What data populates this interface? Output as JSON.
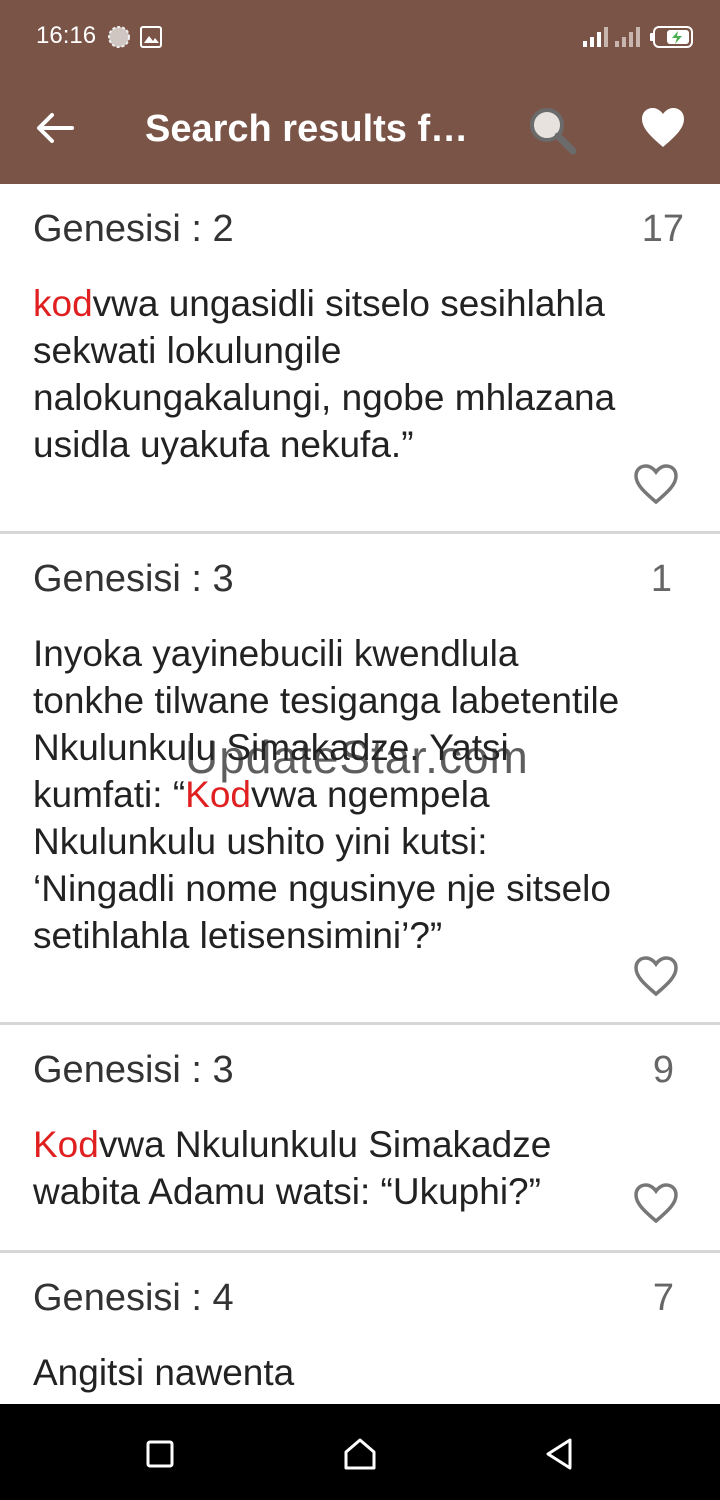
{
  "status_bar": {
    "time": "16:16"
  },
  "toolbar": {
    "title": "Search results f…",
    "back_icon": "arrow-left-icon",
    "search_icon": "magnifier-icon",
    "favorites_icon": "heart-filled-icon"
  },
  "results": [
    {
      "ref": "Genesisi : 2",
      "verse_no": "17",
      "highlight": "kod",
      "prefix": "",
      "rest": "vwa ungasidli sitselo sesihlahla sekwati lokulungile nalokungakalungi, ngobe mhlazana usidla uyakufa nekufa.”"
    },
    {
      "ref": "Genesisi : 3",
      "verse_no": "1",
      "prefix": "Inyoka yayinebucili kwendlula tonkhe tilwane tesiganga labetentile Nkulunkulu Simakadze. Yatsi kumfati: “",
      "highlight": "Kod",
      "rest": "vwa ngempela Nkulunkulu ushito yini kutsi: ‘Ningadli nome ngusinye nje sitselo setihlahla letisensimini’?”"
    },
    {
      "ref": "Genesisi : 3",
      "verse_no": "9",
      "prefix": "",
      "highlight": "Kod",
      "rest": "vwa Nkulunkulu Simakadze wabita Adamu watsi: “Ukuphi?”"
    },
    {
      "ref": "Genesisi : 4",
      "verse_no": "7",
      "prefix": "Angitsi nawenta",
      "highlight": "",
      "rest": ""
    }
  ],
  "watermark": "UpdateStar.com",
  "colors": {
    "appbar": "#7b5448",
    "highlight": "#e02020"
  }
}
